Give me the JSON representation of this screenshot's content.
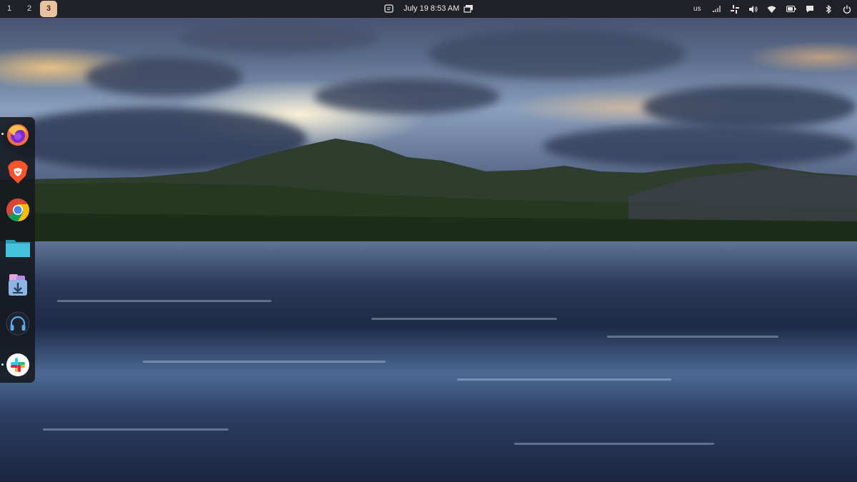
{
  "topbar": {
    "workspaces": [
      {
        "label": "1",
        "active": false
      },
      {
        "label": "2",
        "active": false
      },
      {
        "label": "3",
        "active": true
      }
    ],
    "datetime": "July 19  8:53 AM",
    "keyboard_layout": "us",
    "status_icons": [
      "signal-icon",
      "slack-tray-icon",
      "volume-icon",
      "wifi-icon",
      "battery-icon",
      "chat-icon",
      "bluetooth-icon",
      "power-icon"
    ]
  },
  "dock": {
    "apps": [
      {
        "name": "firefox",
        "running": true
      },
      {
        "name": "brave",
        "running": false
      },
      {
        "name": "chrome",
        "running": false
      },
      {
        "name": "files",
        "running": false
      },
      {
        "name": "software-installer",
        "running": false
      },
      {
        "name": "headphones-player",
        "running": false
      },
      {
        "name": "slack",
        "running": true
      }
    ]
  },
  "colors": {
    "topbar_bg": "#1f2126",
    "active_workspace": "#e8c39e",
    "dock_bg": "#16181e"
  }
}
